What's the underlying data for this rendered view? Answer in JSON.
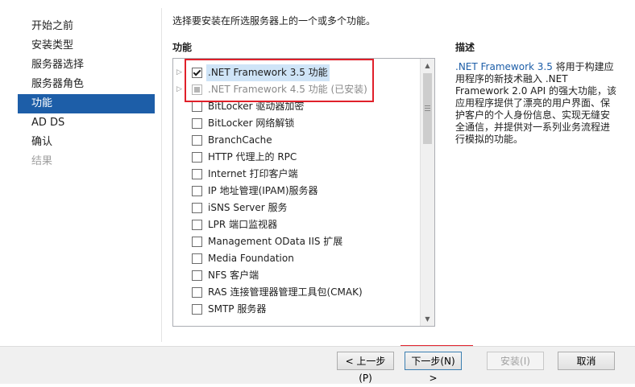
{
  "sidebar": {
    "items": [
      {
        "label": "开始之前",
        "state": "normal"
      },
      {
        "label": "安装类型",
        "state": "normal"
      },
      {
        "label": "服务器选择",
        "state": "normal"
      },
      {
        "label": "服务器角色",
        "state": "normal"
      },
      {
        "label": "功能",
        "state": "active"
      },
      {
        "label": "AD DS",
        "state": "normal"
      },
      {
        "label": "确认",
        "state": "normal"
      },
      {
        "label": "结果",
        "state": "disabled"
      }
    ]
  },
  "main": {
    "instruction": "选择要安装在所选服务器上的一个或多个功能。",
    "features_heading": "功能",
    "features": [
      {
        "label": ".NET Framework 3.5 功能",
        "checked": true,
        "expandable": true,
        "selected": true
      },
      {
        "label": ".NET Framework 4.5 功能 (已安装)",
        "partial": true,
        "expandable": true,
        "grey": true
      },
      {
        "label": "BitLocker 驱动器加密"
      },
      {
        "label": "BitLocker 网络解锁"
      },
      {
        "label": "BranchCache"
      },
      {
        "label": "HTTP 代理上的 RPC"
      },
      {
        "label": "Internet 打印客户端"
      },
      {
        "label": "IP 地址管理(IPAM)服务器"
      },
      {
        "label": "iSNS Server 服务"
      },
      {
        "label": "LPR 端口监视器"
      },
      {
        "label": "Management OData IIS 扩展"
      },
      {
        "label": "Media Foundation"
      },
      {
        "label": "NFS 客户端"
      },
      {
        "label": "RAS 连接管理器管理工具包(CMAK)"
      },
      {
        "label": "SMTP 服务器"
      }
    ],
    "description_heading": "描述",
    "description_link": ".NET Framework 3.5",
    "description_text": " 将用于构建应用程序的新技术融入 .NET Framework 2.0 API 的强大功能，该应用程序提供了漂亮的用户界面、保护客户的个人身份信息、实现无缝安全通信，并提供对一系列业务流程进行模拟的功能。"
  },
  "buttons": {
    "prev": "< 上一步(P)",
    "next": "下一步(N) >",
    "install": "安装(I)",
    "cancel": "取消"
  },
  "colors": {
    "accent": "#1d5ea8",
    "highlight": "#e0202a"
  }
}
